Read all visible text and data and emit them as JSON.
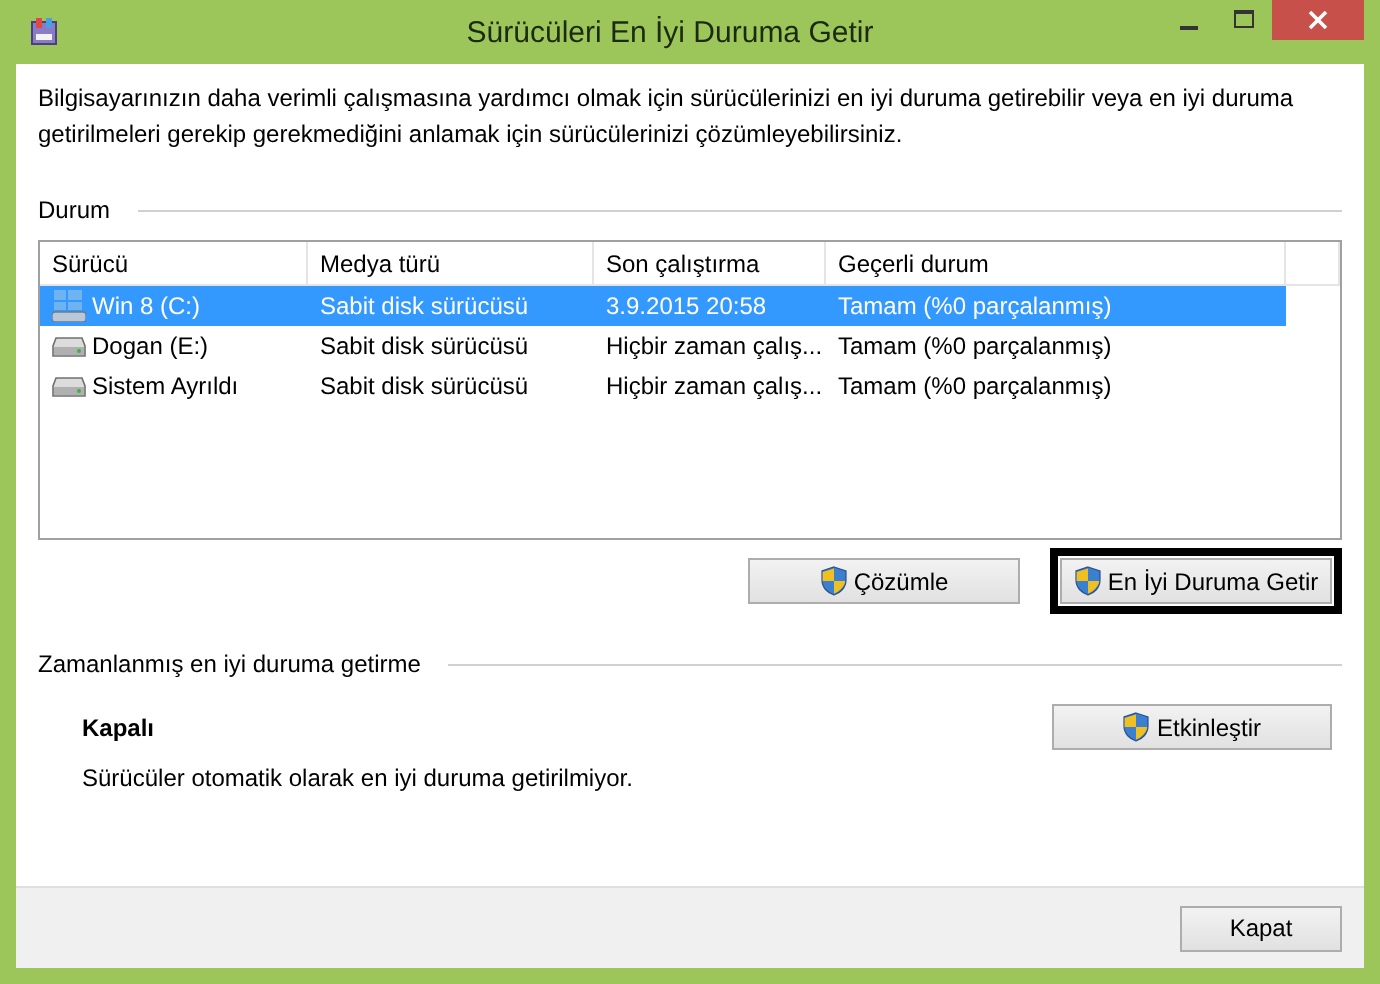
{
  "window": {
    "title": "Sürücüleri En İyi Duruma Getir"
  },
  "description": "Bilgisayarınızın daha verimli çalışmasına yardımcı olmak için sürücülerinizi en iyi duruma getirebilir veya en iyi duruma getirilmeleri gerekip gerekmediğini anlamak için sürücülerinizi çözümleyebilirsiniz.",
  "status": {
    "heading": "Durum",
    "columns": [
      "Sürücü",
      "Medya türü",
      "Son çalıştırma",
      "Geçerli durum"
    ],
    "rows": [
      {
        "kind": "system",
        "selected": true,
        "cells": [
          "Win 8 (C:)",
          "Sabit disk sürücüsü",
          "3.9.2015 20:58",
          "Tamam (%0 parçalanmış)"
        ]
      },
      {
        "kind": "disk",
        "selected": false,
        "cells": [
          "Dogan (E:)",
          "Sabit disk sürücüsü",
          "Hiçbir zaman çalış...",
          "Tamam (%0 parçalanmış)"
        ]
      },
      {
        "kind": "disk",
        "selected": false,
        "cells": [
          "Sistem Ayrıldı",
          "Sabit disk sürücüsü",
          "Hiçbir zaman çalış...",
          "Tamam (%0 parçalanmış)"
        ]
      }
    ],
    "buttons": [
      {
        "label": "Çözümle",
        "focused": false
      },
      {
        "label": "En İyi Duruma Getir",
        "focused": true
      }
    ]
  },
  "schedule": {
    "heading": "Zamanlanmış en iyi duruma getirme",
    "state": "Kapalı",
    "detail": "Sürücüler otomatik olarak en iyi duruma getirilmiyor.",
    "button": "Etkinleştir"
  },
  "footer": {
    "button": "Kapat"
  }
}
